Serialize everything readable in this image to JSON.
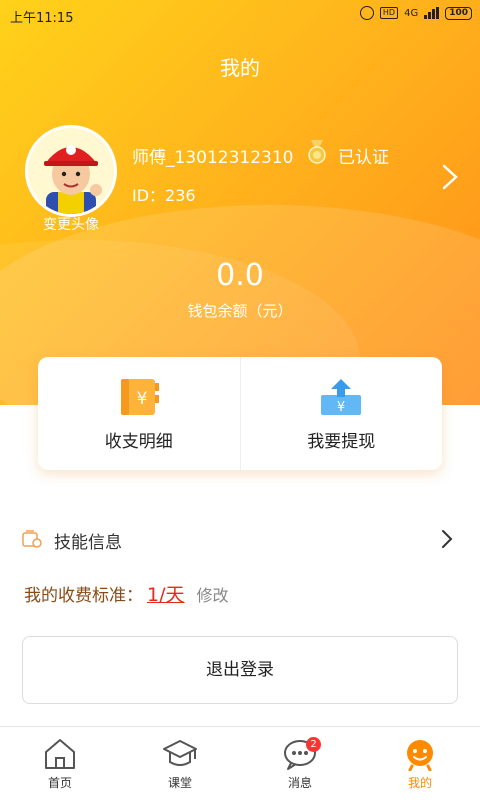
{
  "status_bar": {
    "time": "上午11:15",
    "hd": "HD",
    "network": "4G",
    "battery": "100"
  },
  "header": {
    "title": "我的"
  },
  "profile": {
    "change_avatar": "变更头像",
    "name": "师傅_13012312310",
    "verified": "已认证",
    "id": "ID：236"
  },
  "wallet": {
    "balance": "0.0",
    "label": "钱包余额（元）"
  },
  "actions": [
    {
      "label": "收支明细",
      "icon": "ledger-icon"
    },
    {
      "label": "我要提现",
      "icon": "withdraw-icon"
    }
  ],
  "skill": {
    "label": "技能信息"
  },
  "fee": {
    "label": "我的收费标准：",
    "value": "1/天",
    "edit": "修改"
  },
  "logout": {
    "label": "退出登录"
  },
  "tabs": [
    {
      "label": "首页",
      "icon": "home-icon"
    },
    {
      "label": "课堂",
      "icon": "graduation-cap-icon"
    },
    {
      "label": "消息",
      "icon": "message-icon",
      "badge": "2"
    },
    {
      "label": "我的",
      "icon": "profile-icon",
      "active": true
    }
  ],
  "colors": {
    "accent": "#ff8a00",
    "hero_start": "#ffd21a",
    "hero_end": "#ff8f1a",
    "fee_value": "#e52a1c"
  }
}
